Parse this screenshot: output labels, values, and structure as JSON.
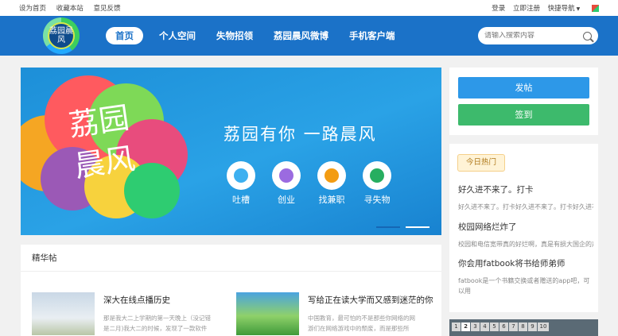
{
  "topbar": {
    "set_home": "设为首页",
    "bookmark": "收藏本站",
    "feedback": "意见反馈",
    "login": "登录",
    "register": "立即注册",
    "quicknav": "快捷导航"
  },
  "nav": {
    "logo_text": "荔园晨风",
    "items": [
      "首页",
      "个人空间",
      "失物招领",
      "荔园晨风微博",
      "手机客户端"
    ],
    "search_placeholder": "请输入搜索内容"
  },
  "banner": {
    "slogan": "荔园有你 一路晨风",
    "big_text": "荔园晨风",
    "features": [
      "吐槽",
      "创业",
      "找兼职",
      "寻失物"
    ]
  },
  "side": {
    "post_button": "发帖",
    "checkin_button": "签到",
    "hot_tag": "今日热门",
    "hot_items": [
      {
        "title": "好久进不来了。打卡",
        "desc": "好久进不来了。打卡好久进不来了。打卡好久进不"
      },
      {
        "title": "校园网络烂炸了",
        "desc": "校园和电信宽带真的好烂啊，真是有损大国企的声"
      },
      {
        "title": "你会用fatbook将书给师弟师",
        "desc": "fatbook是一个书籍交换或者赠送的app吧，可以用"
      }
    ],
    "pager": [
      "1",
      "2",
      "3",
      "4",
      "5",
      "6",
      "7",
      "8",
      "9",
      "10"
    ]
  },
  "essence": {
    "header": "精华帖",
    "posts": [
      {
        "title": "深大在线点播历史",
        "desc": "那是我大二上学期的第一天晚上（没记错是二月)我大二的时候，发现了一款软件下载资源，相"
      },
      {
        "title": "写给正在读大学而又感到迷茫的你",
        "desc": "中国教育，最可怕的不是那些你网络的网游们在网络游戏中的颓废，而是那些所谓，"
      }
    ]
  },
  "colors": {
    "nav_blue": "#1b72c8",
    "post_button": "#2d98e8",
    "checkin_button": "#3dba6c"
  }
}
